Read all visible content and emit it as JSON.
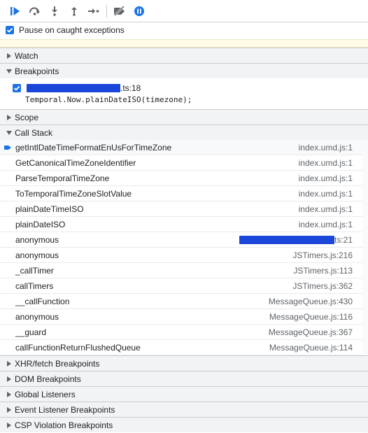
{
  "toolbar": {
    "buttons": [
      {
        "name": "resume-button",
        "icon": "resume-icon"
      },
      {
        "name": "step-over-button",
        "icon": "step-over-icon"
      },
      {
        "name": "step-into-button",
        "icon": "step-into-icon"
      },
      {
        "name": "step-out-button",
        "icon": "step-out-icon"
      },
      {
        "name": "step-button",
        "icon": "step-icon"
      },
      {
        "name": "deactivate-breakpoints-button",
        "icon": "deactivate-breakpoints-icon"
      },
      {
        "name": "pause-on-exceptions-button",
        "icon": "pause-on-exceptions-icon"
      }
    ],
    "accent": "#1a73e8"
  },
  "pause_on_caught": {
    "label": "Pause on caught exceptions",
    "checked": true
  },
  "sections": {
    "watch": "Watch",
    "breakpoints": "Breakpoints",
    "scope": "Scope",
    "call_stack": "Call Stack",
    "xhr": "XHR/fetch Breakpoints",
    "dom": "DOM Breakpoints",
    "global": "Global Listeners",
    "event": "Event Listener Breakpoints",
    "csp": "CSP Violation Breakpoints"
  },
  "breakpoint": {
    "location_suffix": ".ts:18",
    "code": "Temporal.Now.plainDateISO(timezone);",
    "checked": true
  },
  "call_stack": [
    {
      "fn": "getIntlDateTimeFormatEnUsForTimeZone",
      "loc": "index.umd.js:1",
      "current": true
    },
    {
      "fn": "GetCanonicalTimeZoneIdentifier",
      "loc": "index.umd.js:1"
    },
    {
      "fn": "ParseTemporalTimeZone",
      "loc": "index.umd.js:1"
    },
    {
      "fn": "ToTemporalTimeZoneSlotValue",
      "loc": "index.umd.js:1"
    },
    {
      "fn": "plainDateTimeISO",
      "loc": "index.umd.js:1"
    },
    {
      "fn": "plainDateISO",
      "loc": "index.umd.js:1"
    },
    {
      "fn": "anonymous",
      "loc": "ts:21",
      "redacted": true
    },
    {
      "fn": "anonymous",
      "loc": "JSTimers.js:216"
    },
    {
      "fn": "_callTimer",
      "loc": "JSTimers.js:113"
    },
    {
      "fn": "callTimers",
      "loc": "JSTimers.js:362"
    },
    {
      "fn": "__callFunction",
      "loc": "MessageQueue.js:430"
    },
    {
      "fn": "anonymous",
      "loc": "MessageQueue.js:116"
    },
    {
      "fn": "__guard",
      "loc": "MessageQueue.js:367"
    },
    {
      "fn": "callFunctionReturnFlushedQueue",
      "loc": "MessageQueue.js:114"
    }
  ]
}
